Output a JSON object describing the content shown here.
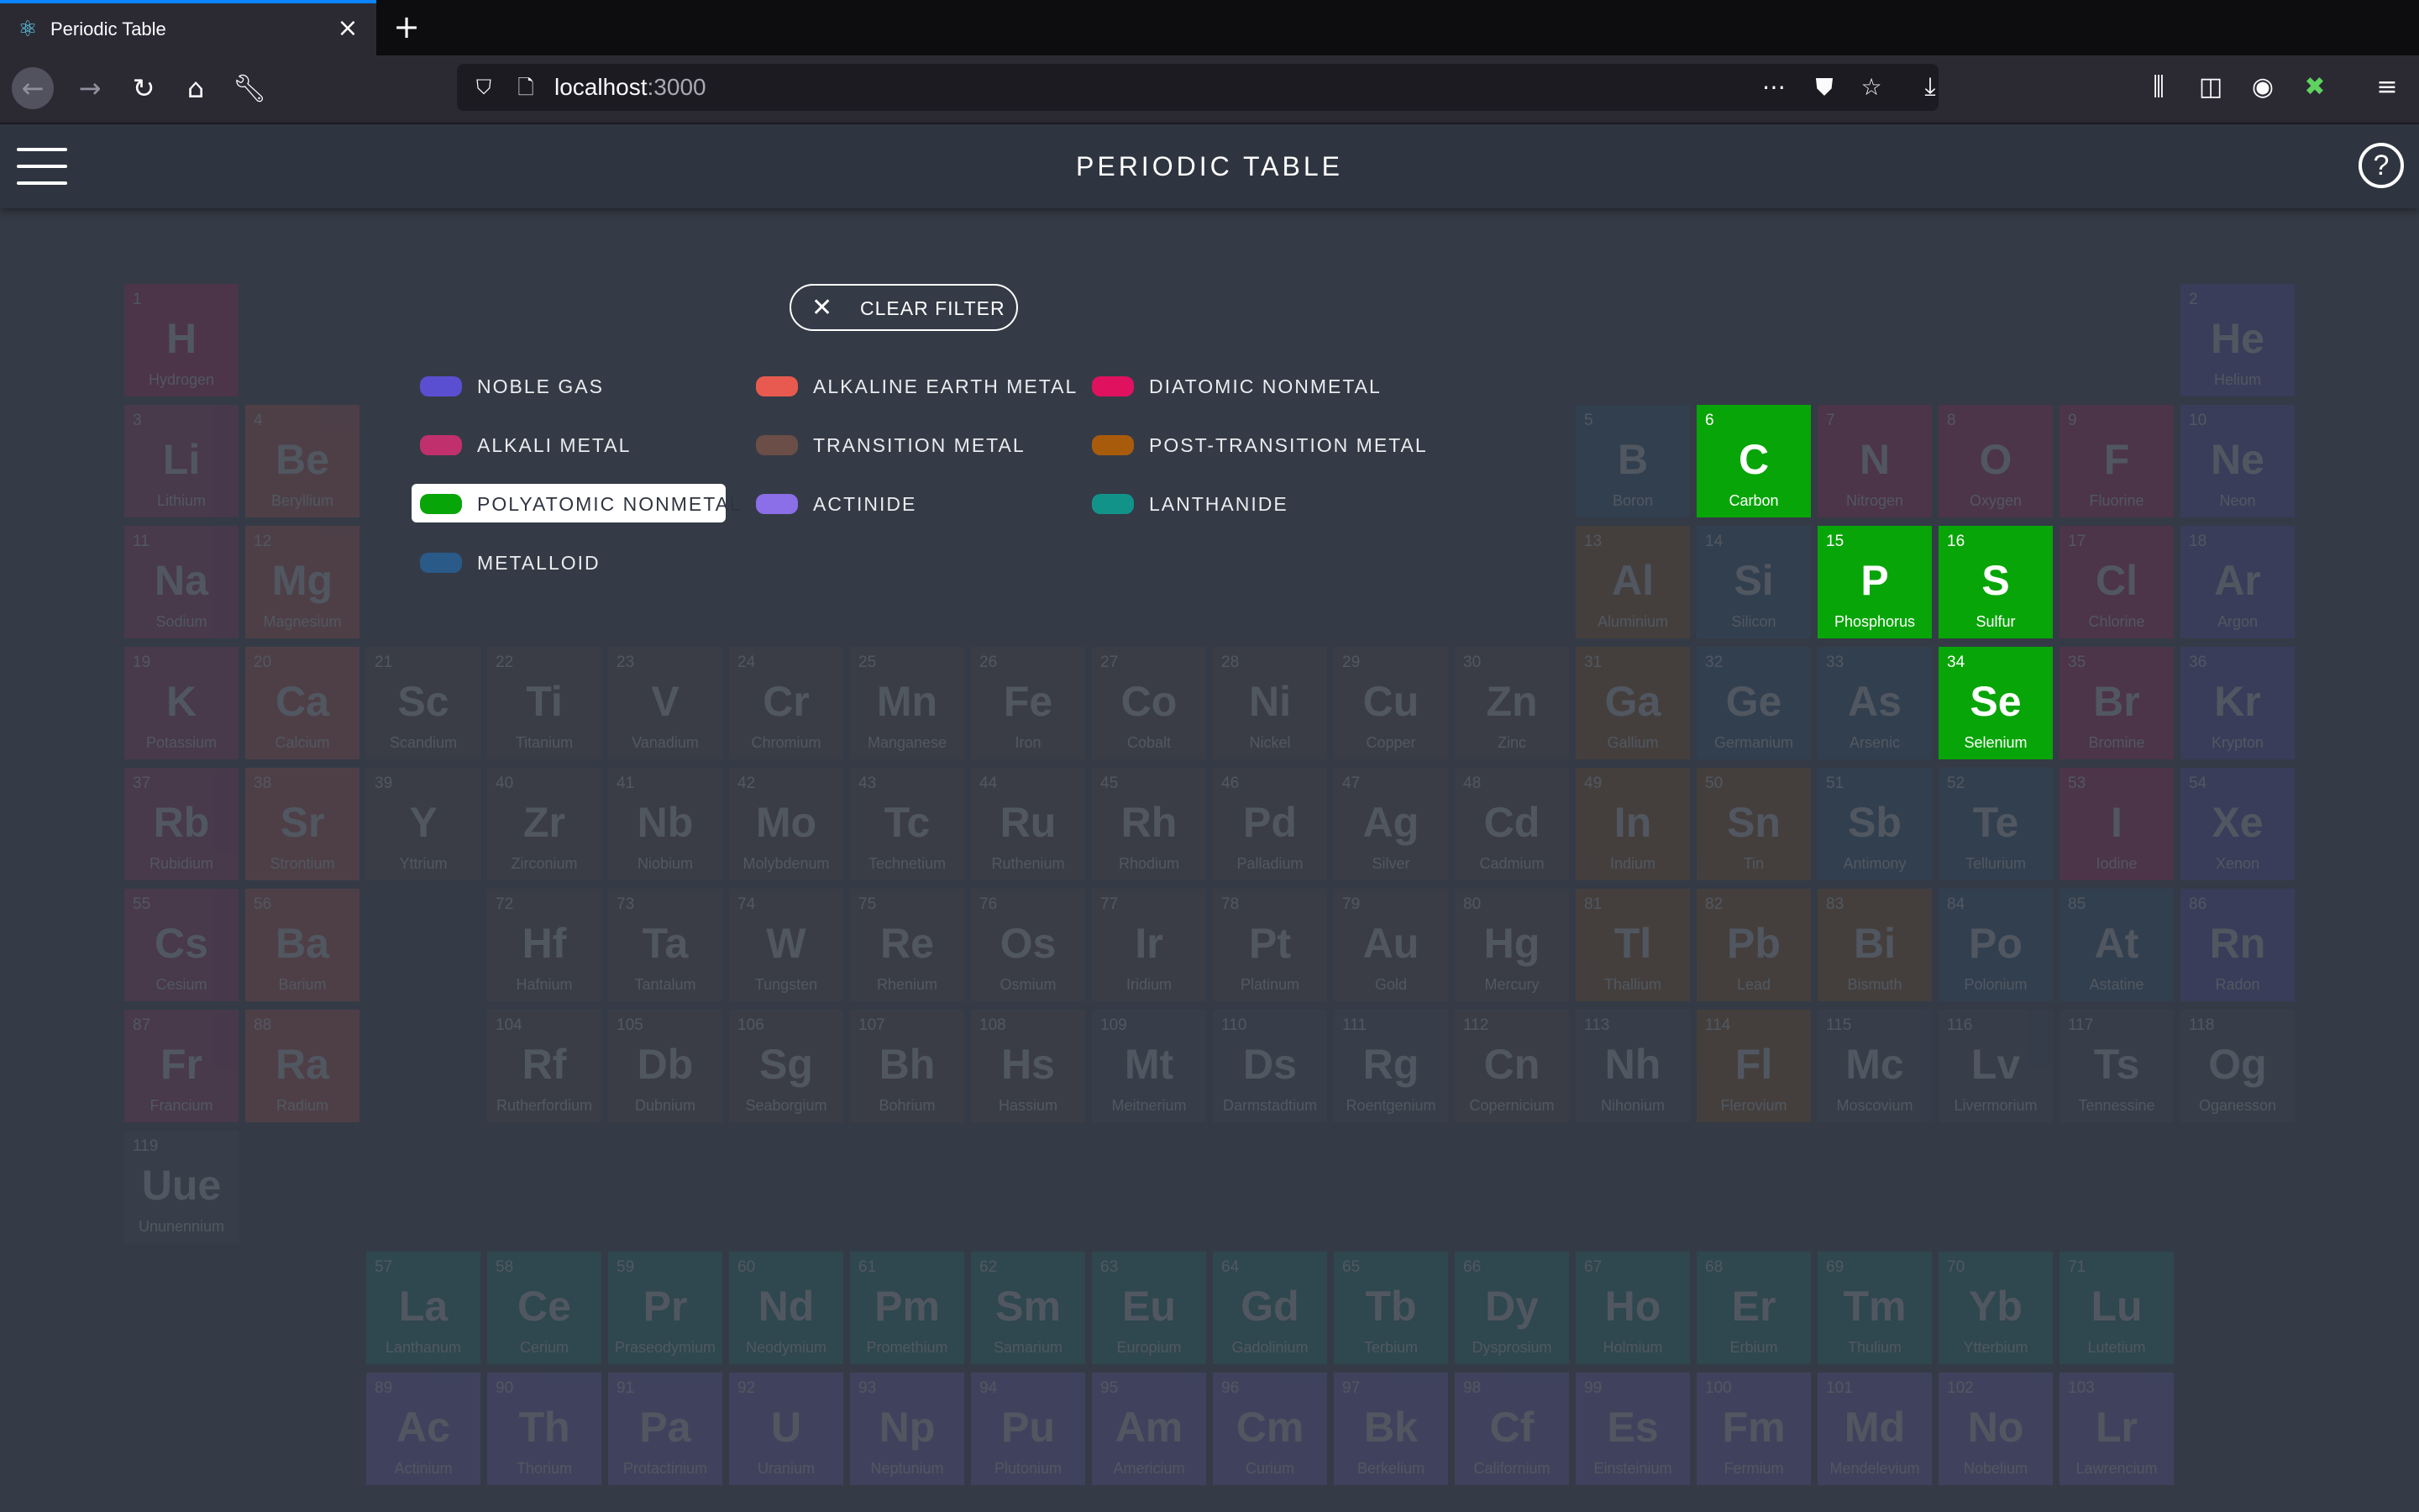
{
  "browser": {
    "tab_title": "Periodic Table",
    "url_host": "localhost",
    "url_port": ":3000"
  },
  "app": {
    "title": "PERIODIC TABLE",
    "help": "?"
  },
  "filter": {
    "clear_label": "CLEAR FILTER",
    "active_category": "polyatomic-nonmetal"
  },
  "categories": {
    "noble-gas": {
      "label": "NOBLE GAS",
      "color": "#5b4fd1"
    },
    "alkaline-earth-metal": {
      "label": "ALKALINE EARTH METAL",
      "color": "#e85a4f"
    },
    "diatomic-nonmetal": {
      "label": "DIATOMIC NONMETAL",
      "color": "#e0115f"
    },
    "alkali-metal": {
      "label": "ALKALI METAL",
      "color": "#c0306c"
    },
    "transition-metal": {
      "label": "TRANSITION METAL",
      "color": "#6b4e47"
    },
    "post-transition-metal": {
      "label": "POST-TRANSITION METAL",
      "color": "#a85c0b"
    },
    "polyatomic-nonmetal": {
      "label": "POLYATOMIC NONMETAL",
      "color": "#08a508"
    },
    "actinide": {
      "label": "ACTINIDE",
      "color": "#8a6fe8"
    },
    "lanthanide": {
      "label": "LANTHANIDE",
      "color": "#12938a"
    },
    "metalloid": {
      "label": "METALLOID",
      "color": "#2a5a88"
    },
    "unknown": {
      "label": "",
      "color": "#4a5160"
    }
  },
  "legend_order": [
    [
      "noble-gas",
      "alkaline-earth-metal",
      "diatomic-nonmetal"
    ],
    [
      "alkali-metal",
      "transition-metal",
      "post-transition-metal"
    ],
    [
      "polyatomic-nonmetal",
      "actinide",
      "lanthanide"
    ],
    [
      "metalloid"
    ]
  ],
  "elements": [
    {
      "n": 1,
      "s": "H",
      "name": "Hydrogen",
      "c": "diatomic-nonmetal",
      "g": 1,
      "p": 1
    },
    {
      "n": 2,
      "s": "He",
      "name": "Helium",
      "c": "noble-gas",
      "g": 18,
      "p": 1
    },
    {
      "n": 3,
      "s": "Li",
      "name": "Lithium",
      "c": "alkali-metal",
      "g": 1,
      "p": 2
    },
    {
      "n": 4,
      "s": "Be",
      "name": "Beryllium",
      "c": "alkaline-earth-metal",
      "g": 2,
      "p": 2
    },
    {
      "n": 5,
      "s": "B",
      "name": "Boron",
      "c": "metalloid",
      "g": 13,
      "p": 2
    },
    {
      "n": 6,
      "s": "C",
      "name": "Carbon",
      "c": "polyatomic-nonmetal",
      "g": 14,
      "p": 2
    },
    {
      "n": 7,
      "s": "N",
      "name": "Nitrogen",
      "c": "diatomic-nonmetal",
      "g": 15,
      "p": 2
    },
    {
      "n": 8,
      "s": "O",
      "name": "Oxygen",
      "c": "diatomic-nonmetal",
      "g": 16,
      "p": 2
    },
    {
      "n": 9,
      "s": "F",
      "name": "Fluorine",
      "c": "diatomic-nonmetal",
      "g": 17,
      "p": 2
    },
    {
      "n": 10,
      "s": "Ne",
      "name": "Neon",
      "c": "noble-gas",
      "g": 18,
      "p": 2
    },
    {
      "n": 11,
      "s": "Na",
      "name": "Sodium",
      "c": "alkali-metal",
      "g": 1,
      "p": 3
    },
    {
      "n": 12,
      "s": "Mg",
      "name": "Magnesium",
      "c": "alkaline-earth-metal",
      "g": 2,
      "p": 3
    },
    {
      "n": 13,
      "s": "Al",
      "name": "Aluminium",
      "c": "post-transition-metal",
      "g": 13,
      "p": 3
    },
    {
      "n": 14,
      "s": "Si",
      "name": "Silicon",
      "c": "metalloid",
      "g": 14,
      "p": 3
    },
    {
      "n": 15,
      "s": "P",
      "name": "Phosphorus",
      "c": "polyatomic-nonmetal",
      "g": 15,
      "p": 3
    },
    {
      "n": 16,
      "s": "S",
      "name": "Sulfur",
      "c": "polyatomic-nonmetal",
      "g": 16,
      "p": 3
    },
    {
      "n": 17,
      "s": "Cl",
      "name": "Chlorine",
      "c": "diatomic-nonmetal",
      "g": 17,
      "p": 3
    },
    {
      "n": 18,
      "s": "Ar",
      "name": "Argon",
      "c": "noble-gas",
      "g": 18,
      "p": 3
    },
    {
      "n": 19,
      "s": "K",
      "name": "Potassium",
      "c": "alkali-metal",
      "g": 1,
      "p": 4
    },
    {
      "n": 20,
      "s": "Ca",
      "name": "Calcium",
      "c": "alkaline-earth-metal",
      "g": 2,
      "p": 4
    },
    {
      "n": 21,
      "s": "Sc",
      "name": "Scandium",
      "c": "transition-metal",
      "g": 3,
      "p": 4
    },
    {
      "n": 22,
      "s": "Ti",
      "name": "Titanium",
      "c": "transition-metal",
      "g": 4,
      "p": 4
    },
    {
      "n": 23,
      "s": "V",
      "name": "Vanadium",
      "c": "transition-metal",
      "g": 5,
      "p": 4
    },
    {
      "n": 24,
      "s": "Cr",
      "name": "Chromium",
      "c": "transition-metal",
      "g": 6,
      "p": 4
    },
    {
      "n": 25,
      "s": "Mn",
      "name": "Manganese",
      "c": "transition-metal",
      "g": 7,
      "p": 4
    },
    {
      "n": 26,
      "s": "Fe",
      "name": "Iron",
      "c": "transition-metal",
      "g": 8,
      "p": 4
    },
    {
      "n": 27,
      "s": "Co",
      "name": "Cobalt",
      "c": "transition-metal",
      "g": 9,
      "p": 4
    },
    {
      "n": 28,
      "s": "Ni",
      "name": "Nickel",
      "c": "transition-metal",
      "g": 10,
      "p": 4
    },
    {
      "n": 29,
      "s": "Cu",
      "name": "Copper",
      "c": "transition-metal",
      "g": 11,
      "p": 4
    },
    {
      "n": 30,
      "s": "Zn",
      "name": "Zinc",
      "c": "transition-metal",
      "g": 12,
      "p": 4
    },
    {
      "n": 31,
      "s": "Ga",
      "name": "Gallium",
      "c": "post-transition-metal",
      "g": 13,
      "p": 4
    },
    {
      "n": 32,
      "s": "Ge",
      "name": "Germanium",
      "c": "metalloid",
      "g": 14,
      "p": 4
    },
    {
      "n": 33,
      "s": "As",
      "name": "Arsenic",
      "c": "metalloid",
      "g": 15,
      "p": 4
    },
    {
      "n": 34,
      "s": "Se",
      "name": "Selenium",
      "c": "polyatomic-nonmetal",
      "g": 16,
      "p": 4
    },
    {
      "n": 35,
      "s": "Br",
      "name": "Bromine",
      "c": "diatomic-nonmetal",
      "g": 17,
      "p": 4
    },
    {
      "n": 36,
      "s": "Kr",
      "name": "Krypton",
      "c": "noble-gas",
      "g": 18,
      "p": 4
    },
    {
      "n": 37,
      "s": "Rb",
      "name": "Rubidium",
      "c": "alkali-metal",
      "g": 1,
      "p": 5
    },
    {
      "n": 38,
      "s": "Sr",
      "name": "Strontium",
      "c": "alkaline-earth-metal",
      "g": 2,
      "p": 5
    },
    {
      "n": 39,
      "s": "Y",
      "name": "Yttrium",
      "c": "transition-metal",
      "g": 3,
      "p": 5
    },
    {
      "n": 40,
      "s": "Zr",
      "name": "Zirconium",
      "c": "transition-metal",
      "g": 4,
      "p": 5
    },
    {
      "n": 41,
      "s": "Nb",
      "name": "Niobium",
      "c": "transition-metal",
      "g": 5,
      "p": 5
    },
    {
      "n": 42,
      "s": "Mo",
      "name": "Molybdenum",
      "c": "transition-metal",
      "g": 6,
      "p": 5
    },
    {
      "n": 43,
      "s": "Tc",
      "name": "Technetium",
      "c": "transition-metal",
      "g": 7,
      "p": 5
    },
    {
      "n": 44,
      "s": "Ru",
      "name": "Ruthenium",
      "c": "transition-metal",
      "g": 8,
      "p": 5
    },
    {
      "n": 45,
      "s": "Rh",
      "name": "Rhodium",
      "c": "transition-metal",
      "g": 9,
      "p": 5
    },
    {
      "n": 46,
      "s": "Pd",
      "name": "Palladium",
      "c": "transition-metal",
      "g": 10,
      "p": 5
    },
    {
      "n": 47,
      "s": "Ag",
      "name": "Silver",
      "c": "transition-metal",
      "g": 11,
      "p": 5
    },
    {
      "n": 48,
      "s": "Cd",
      "name": "Cadmium",
      "c": "transition-metal",
      "g": 12,
      "p": 5
    },
    {
      "n": 49,
      "s": "In",
      "name": "Indium",
      "c": "post-transition-metal",
      "g": 13,
      "p": 5
    },
    {
      "n": 50,
      "s": "Sn",
      "name": "Tin",
      "c": "post-transition-metal",
      "g": 14,
      "p": 5
    },
    {
      "n": 51,
      "s": "Sb",
      "name": "Antimony",
      "c": "metalloid",
      "g": 15,
      "p": 5
    },
    {
      "n": 52,
      "s": "Te",
      "name": "Tellurium",
      "c": "metalloid",
      "g": 16,
      "p": 5
    },
    {
      "n": 53,
      "s": "I",
      "name": "Iodine",
      "c": "diatomic-nonmetal",
      "g": 17,
      "p": 5
    },
    {
      "n": 54,
      "s": "Xe",
      "name": "Xenon",
      "c": "noble-gas",
      "g": 18,
      "p": 5
    },
    {
      "n": 55,
      "s": "Cs",
      "name": "Cesium",
      "c": "alkali-metal",
      "g": 1,
      "p": 6
    },
    {
      "n": 56,
      "s": "Ba",
      "name": "Barium",
      "c": "alkaline-earth-metal",
      "g": 2,
      "p": 6
    },
    {
      "n": 72,
      "s": "Hf",
      "name": "Hafnium",
      "c": "transition-metal",
      "g": 4,
      "p": 6
    },
    {
      "n": 73,
      "s": "Ta",
      "name": "Tantalum",
      "c": "transition-metal",
      "g": 5,
      "p": 6
    },
    {
      "n": 74,
      "s": "W",
      "name": "Tungsten",
      "c": "transition-metal",
      "g": 6,
      "p": 6
    },
    {
      "n": 75,
      "s": "Re",
      "name": "Rhenium",
      "c": "transition-metal",
      "g": 7,
      "p": 6
    },
    {
      "n": 76,
      "s": "Os",
      "name": "Osmium",
      "c": "transition-metal",
      "g": 8,
      "p": 6
    },
    {
      "n": 77,
      "s": "Ir",
      "name": "Iridium",
      "c": "transition-metal",
      "g": 9,
      "p": 6
    },
    {
      "n": 78,
      "s": "Pt",
      "name": "Platinum",
      "c": "transition-metal",
      "g": 10,
      "p": 6
    },
    {
      "n": 79,
      "s": "Au",
      "name": "Gold",
      "c": "transition-metal",
      "g": 11,
      "p": 6
    },
    {
      "n": 80,
      "s": "Hg",
      "name": "Mercury",
      "c": "transition-metal",
      "g": 12,
      "p": 6
    },
    {
      "n": 81,
      "s": "Tl",
      "name": "Thallium",
      "c": "post-transition-metal",
      "g": 13,
      "p": 6
    },
    {
      "n": 82,
      "s": "Pb",
      "name": "Lead",
      "c": "post-transition-metal",
      "g": 14,
      "p": 6
    },
    {
      "n": 83,
      "s": "Bi",
      "name": "Bismuth",
      "c": "post-transition-metal",
      "g": 15,
      "p": 6
    },
    {
      "n": 84,
      "s": "Po",
      "name": "Polonium",
      "c": "metalloid",
      "g": 16,
      "p": 6
    },
    {
      "n": 85,
      "s": "At",
      "name": "Astatine",
      "c": "metalloid",
      "g": 17,
      "p": 6
    },
    {
      "n": 86,
      "s": "Rn",
      "name": "Radon",
      "c": "noble-gas",
      "g": 18,
      "p": 6
    },
    {
      "n": 87,
      "s": "Fr",
      "name": "Francium",
      "c": "alkali-metal",
      "g": 1,
      "p": 7
    },
    {
      "n": 88,
      "s": "Ra",
      "name": "Radium",
      "c": "alkaline-earth-metal",
      "g": 2,
      "p": 7
    },
    {
      "n": 104,
      "s": "Rf",
      "name": "Rutherfordium",
      "c": "transition-metal",
      "g": 4,
      "p": 7
    },
    {
      "n": 105,
      "s": "Db",
      "name": "Dubnium",
      "c": "transition-metal",
      "g": 5,
      "p": 7
    },
    {
      "n": 106,
      "s": "Sg",
      "name": "Seaborgium",
      "c": "transition-metal",
      "g": 6,
      "p": 7
    },
    {
      "n": 107,
      "s": "Bh",
      "name": "Bohrium",
      "c": "transition-metal",
      "g": 7,
      "p": 7
    },
    {
      "n": 108,
      "s": "Hs",
      "name": "Hassium",
      "c": "transition-metal",
      "g": 8,
      "p": 7
    },
    {
      "n": 109,
      "s": "Mt",
      "name": "Meitnerium",
      "c": "unknown",
      "g": 9,
      "p": 7
    },
    {
      "n": 110,
      "s": "Ds",
      "name": "Darmstadtium",
      "c": "unknown",
      "g": 10,
      "p": 7
    },
    {
      "n": 111,
      "s": "Rg",
      "name": "Roentgenium",
      "c": "unknown",
      "g": 11,
      "p": 7
    },
    {
      "n": 112,
      "s": "Cn",
      "name": "Copernicium",
      "c": "transition-metal",
      "g": 12,
      "p": 7
    },
    {
      "n": 113,
      "s": "Nh",
      "name": "Nihonium",
      "c": "unknown",
      "g": 13,
      "p": 7
    },
    {
      "n": 114,
      "s": "Fl",
      "name": "Flerovium",
      "c": "post-transition-metal",
      "g": 14,
      "p": 7
    },
    {
      "n": 115,
      "s": "Mc",
      "name": "Moscovium",
      "c": "unknown",
      "g": 15,
      "p": 7
    },
    {
      "n": 116,
      "s": "Lv",
      "name": "Livermorium",
      "c": "unknown",
      "g": 16,
      "p": 7
    },
    {
      "n": 117,
      "s": "Ts",
      "name": "Tennessine",
      "c": "unknown",
      "g": 17,
      "p": 7
    },
    {
      "n": 118,
      "s": "Og",
      "name": "Oganesson",
      "c": "unknown",
      "g": 18,
      "p": 7
    },
    {
      "n": 119,
      "s": "Uue",
      "name": "Ununennium",
      "c": "unknown",
      "g": 1,
      "p": 8
    },
    {
      "n": 57,
      "s": "La",
      "name": "Lanthanum",
      "c": "lanthanide",
      "g": 3,
      "p": 10
    },
    {
      "n": 58,
      "s": "Ce",
      "name": "Cerium",
      "c": "lanthanide",
      "g": 4,
      "p": 10
    },
    {
      "n": 59,
      "s": "Pr",
      "name": "Praseodymium",
      "c": "lanthanide",
      "g": 5,
      "p": 10
    },
    {
      "n": 60,
      "s": "Nd",
      "name": "Neodymium",
      "c": "lanthanide",
      "g": 6,
      "p": 10
    },
    {
      "n": 61,
      "s": "Pm",
      "name": "Promethium",
      "c": "lanthanide",
      "g": 7,
      "p": 10
    },
    {
      "n": 62,
      "s": "Sm",
      "name": "Samarium",
      "c": "lanthanide",
      "g": 8,
      "p": 10
    },
    {
      "n": 63,
      "s": "Eu",
      "name": "Europium",
      "c": "lanthanide",
      "g": 9,
      "p": 10
    },
    {
      "n": 64,
      "s": "Gd",
      "name": "Gadolinium",
      "c": "lanthanide",
      "g": 10,
      "p": 10
    },
    {
      "n": 65,
      "s": "Tb",
      "name": "Terbium",
      "c": "lanthanide",
      "g": 11,
      "p": 10
    },
    {
      "n": 66,
      "s": "Dy",
      "name": "Dysprosium",
      "c": "lanthanide",
      "g": 12,
      "p": 10
    },
    {
      "n": 67,
      "s": "Ho",
      "name": "Holmium",
      "c": "lanthanide",
      "g": 13,
      "p": 10
    },
    {
      "n": 68,
      "s": "Er",
      "name": "Erbium",
      "c": "lanthanide",
      "g": 14,
      "p": 10
    },
    {
      "n": 69,
      "s": "Tm",
      "name": "Thulium",
      "c": "lanthanide",
      "g": 15,
      "p": 10
    },
    {
      "n": 70,
      "s": "Yb",
      "name": "Ytterbium",
      "c": "lanthanide",
      "g": 16,
      "p": 10
    },
    {
      "n": 71,
      "s": "Lu",
      "name": "Lutetium",
      "c": "lanthanide",
      "g": 17,
      "p": 10
    },
    {
      "n": 89,
      "s": "Ac",
      "name": "Actinium",
      "c": "actinide",
      "g": 3,
      "p": 11
    },
    {
      "n": 90,
      "s": "Th",
      "name": "Thorium",
      "c": "actinide",
      "g": 4,
      "p": 11
    },
    {
      "n": 91,
      "s": "Pa",
      "name": "Protactinium",
      "c": "actinide",
      "g": 5,
      "p": 11
    },
    {
      "n": 92,
      "s": "U",
      "name": "Uranium",
      "c": "actinide",
      "g": 6,
      "p": 11
    },
    {
      "n": 93,
      "s": "Np",
      "name": "Neptunium",
      "c": "actinide",
      "g": 7,
      "p": 11
    },
    {
      "n": 94,
      "s": "Pu",
      "name": "Plutonium",
      "c": "actinide",
      "g": 8,
      "p": 11
    },
    {
      "n": 95,
      "s": "Am",
      "name": "Americium",
      "c": "actinide",
      "g": 9,
      "p": 11
    },
    {
      "n": 96,
      "s": "Cm",
      "name": "Curium",
      "c": "actinide",
      "g": 10,
      "p": 11
    },
    {
      "n": 97,
      "s": "Bk",
      "name": "Berkelium",
      "c": "actinide",
      "g": 11,
      "p": 11
    },
    {
      "n": 98,
      "s": "Cf",
      "name": "Californium",
      "c": "actinide",
      "g": 12,
      "p": 11
    },
    {
      "n": 99,
      "s": "Es",
      "name": "Einsteinium",
      "c": "actinide",
      "g": 13,
      "p": 11
    },
    {
      "n": 100,
      "s": "Fm",
      "name": "Fermium",
      "c": "actinide",
      "g": 14,
      "p": 11
    },
    {
      "n": 101,
      "s": "Md",
      "name": "Mendelevium",
      "c": "actinide",
      "g": 15,
      "p": 11
    },
    {
      "n": 102,
      "s": "No",
      "name": "Nobelium",
      "c": "actinide",
      "g": 16,
      "p": 11
    },
    {
      "n": 103,
      "s": "Lr",
      "name": "Lawrencium",
      "c": "actinide",
      "g": 17,
      "p": 11
    }
  ]
}
